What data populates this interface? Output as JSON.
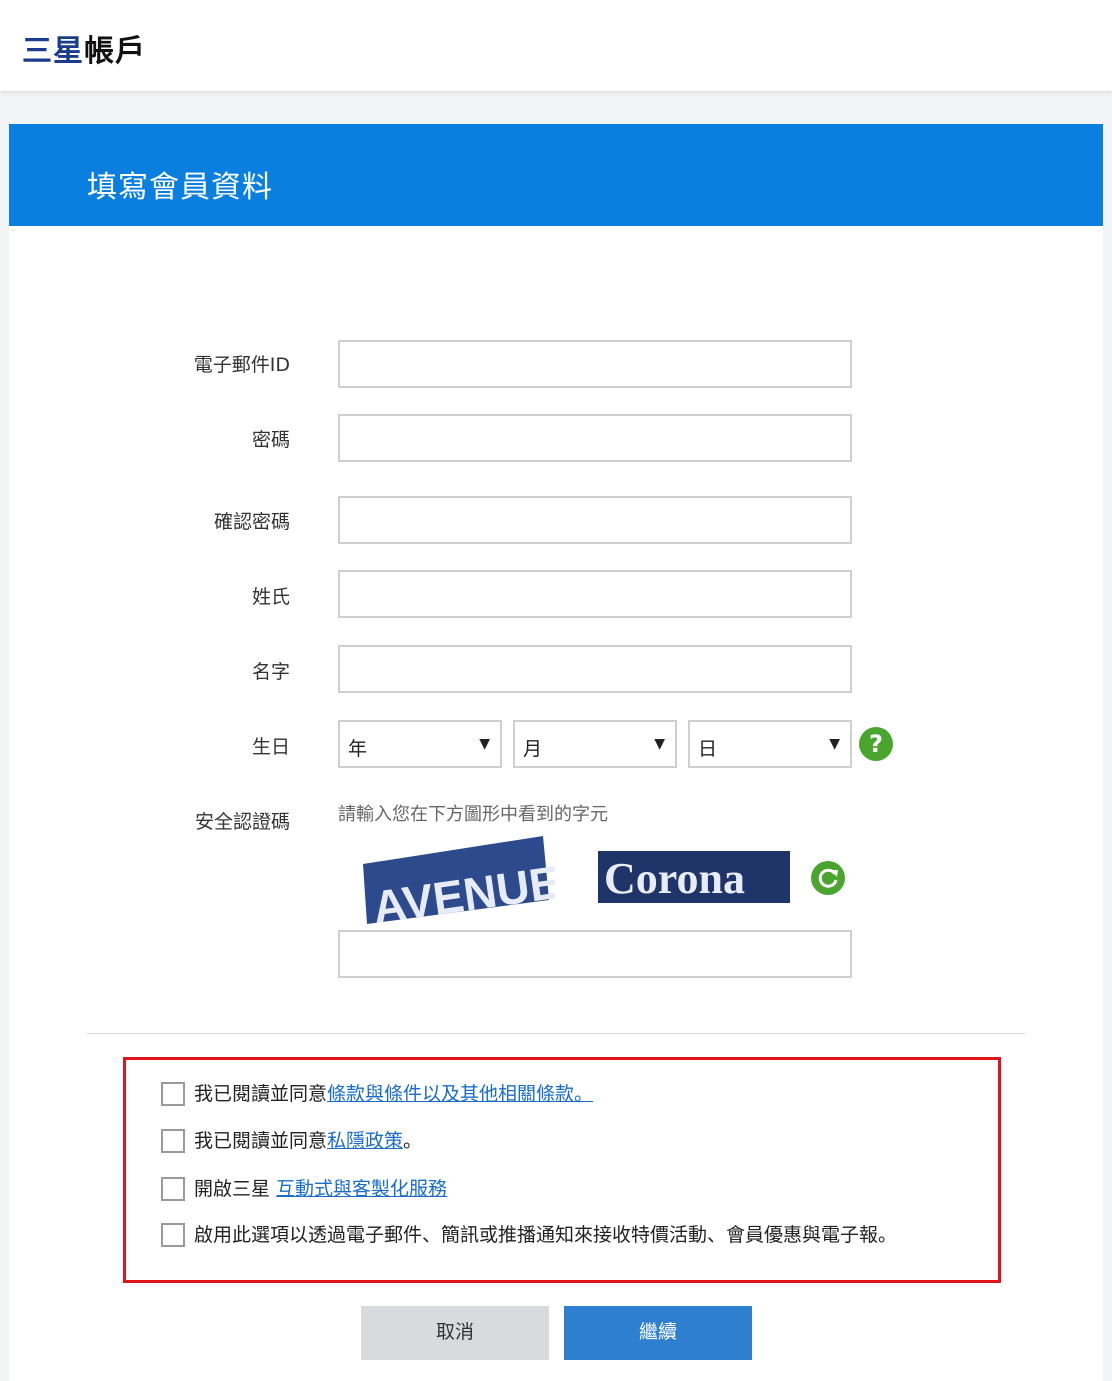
{
  "header": {
    "brand_part1": "三星",
    "brand_part2": "帳戶"
  },
  "form": {
    "title": "填寫會員資料",
    "labels": {
      "email": "電子郵件ID",
      "password": "密碼",
      "confirm_password": "確認密碼",
      "last_name": "姓氏",
      "first_name": "名字",
      "birthday": "生日",
      "captcha": "安全認證碼"
    },
    "birthday": {
      "year": "年",
      "month": "月",
      "day": "日"
    },
    "captcha_hint": "請輸入您在下方圖形中看到的字元",
    "captcha_words": [
      "AVENUE",
      "Corona"
    ]
  },
  "agreements": [
    {
      "prefix": "我已閱讀並同意",
      "link": "條款與條件以及其他相關條款。",
      "suffix": ""
    },
    {
      "prefix": "我已閱讀並同意",
      "link": "私隱政策",
      "suffix": "。"
    },
    {
      "prefix": "開啟三星 ",
      "link": "互動式與客製化服務",
      "suffix": ""
    },
    {
      "prefix": "啟用此選項以透過電子郵件、簡訊或推播通知來接收特價活動、會員優惠與電子報。",
      "link": "",
      "suffix": ""
    }
  ],
  "buttons": {
    "cancel": "取消",
    "continue": "繼續"
  },
  "colors": {
    "header_blue": "#0a7fe0",
    "continue_blue": "#2e7fd0",
    "highlight_red": "#e0141d",
    "help_green": "#4aa52e"
  }
}
